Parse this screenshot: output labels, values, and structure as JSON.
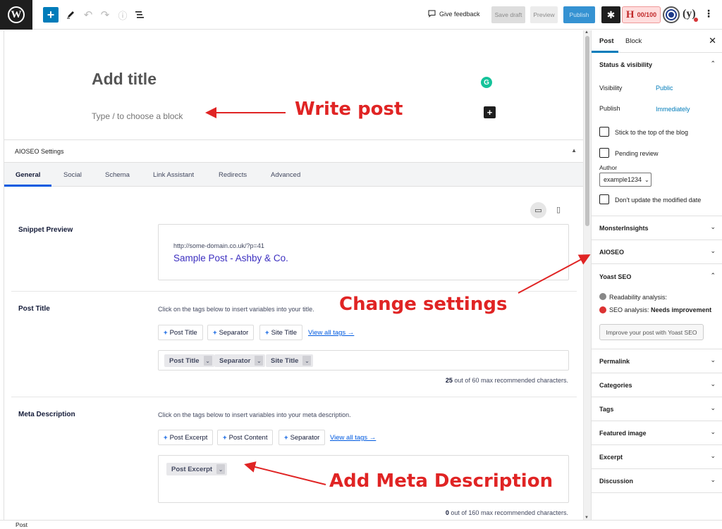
{
  "toolbar": {
    "feedback_label": "Give feedback",
    "save_draft_label": "Save draft",
    "preview_label": "Preview",
    "publish_label": "Publish",
    "headline_score": "00/100"
  },
  "editor": {
    "title_placeholder": "Add title",
    "block_placeholder": "Type / to choose a block"
  },
  "aioseo": {
    "panel_title": "AIOSEO Settings",
    "tabs": [
      {
        "label": "General"
      },
      {
        "label": "Social"
      },
      {
        "label": "Schema"
      },
      {
        "label": "Link Assistant"
      },
      {
        "label": "Redirects"
      },
      {
        "label": "Advanced"
      }
    ],
    "snippet": {
      "label": "Snippet Preview",
      "url": "http://some-domain.co.uk/?p=41",
      "title": "Sample Post - Ashby & Co."
    },
    "post_title": {
      "label": "Post Title",
      "hint": "Click on the tags below to insert variables into your title.",
      "tag_buttons": [
        "Post Title",
        "Separator",
        "Site Title"
      ],
      "view_all": "View all tags →",
      "chips": [
        "Post Title",
        "Separator",
        "Site Title"
      ],
      "count_value": "25",
      "count_text": "out of 60 max recommended characters."
    },
    "meta_description": {
      "label": "Meta Description",
      "hint": "Click on the tags below to insert variables into your meta description.",
      "tag_buttons": [
        "Post Excerpt",
        "Post Content",
        "Separator"
      ],
      "view_all": "View all tags →",
      "chips": [
        "Post Excerpt"
      ],
      "count_value": "0",
      "count_text": "out of 160 max recommended characters."
    }
  },
  "sidebar": {
    "tabs": [
      {
        "label": "Post"
      },
      {
        "label": "Block"
      }
    ],
    "status": {
      "title": "Status & visibility",
      "visibility_label": "Visibility",
      "visibility_value": "Public",
      "publish_label": "Publish",
      "publish_value": "Immediately",
      "sticky_label": "Stick to the top of the blog",
      "pending_label": "Pending review",
      "author_label": "Author",
      "author_value": "example1234",
      "modified_label": "Don't update the modified date"
    },
    "panels_mid": [
      "MonsterInsights",
      "AIOSEO"
    ],
    "yoast": {
      "title": "Yoast SEO",
      "readability": "Readability analysis:",
      "seo_prefix": "SEO analysis:",
      "seo_status": "Needs improvement",
      "button": "Improve your post with Yoast SEO"
    },
    "panels_bottom": [
      "Permalink",
      "Categories",
      "Tags",
      "Featured image",
      "Excerpt",
      "Discussion"
    ]
  },
  "status_bar": {
    "breadcrumb": "Post"
  },
  "annotations": {
    "write_post": "Write post",
    "change_settings": "Change settings",
    "add_meta": "Add Meta Description"
  },
  "colors": {
    "accent": "#007cba",
    "annotation_red": "#e02424",
    "aioseo_blue": "#005ae0"
  }
}
